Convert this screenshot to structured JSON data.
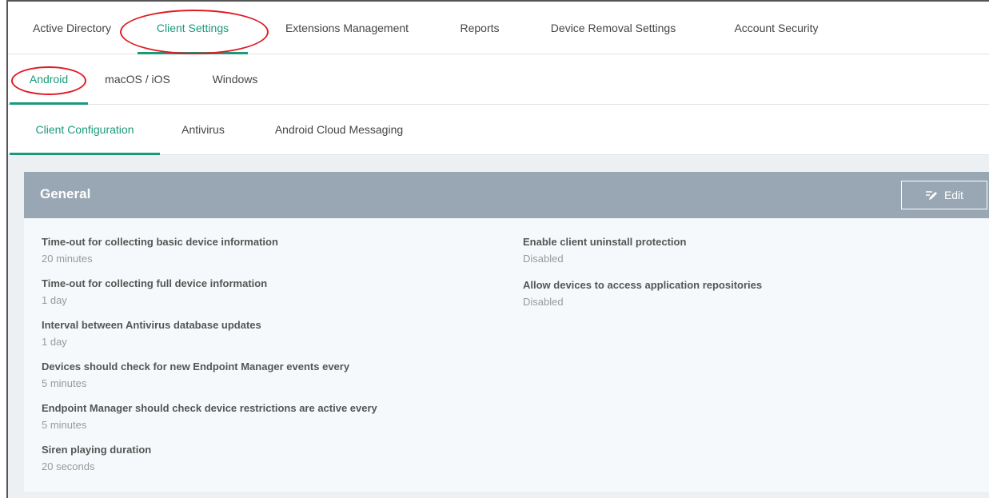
{
  "top_tabs": [
    "Active Directory",
    "Client Settings",
    "Extensions Management",
    "Reports",
    "Device Removal Settings",
    "Account Security"
  ],
  "os_tabs": [
    "Android",
    "macOS / iOS",
    "Windows"
  ],
  "section_tabs": [
    "Client Configuration",
    "Antivirus",
    "Android Cloud Messaging"
  ],
  "card": {
    "title": "General",
    "edit_label": "Edit",
    "left_fields": [
      {
        "label": "Time-out for collecting basic device information",
        "value": "20 minutes"
      },
      {
        "label": "Time-out for collecting full device information",
        "value": "1 day"
      },
      {
        "label": "Interval between Antivirus database updates",
        "value": "1 day"
      },
      {
        "label": "Devices should check for new Endpoint Manager events every",
        "value": "5 minutes"
      },
      {
        "label": "Endpoint Manager should check device restrictions are active every",
        "value": "5 minutes"
      },
      {
        "label": "Siren playing duration",
        "value": "20 seconds"
      }
    ],
    "right_fields": [
      {
        "label": "Enable client uninstall protection",
        "value": "Disabled"
      },
      {
        "label": "Allow devices to access application repositories",
        "value": "Disabled"
      }
    ]
  },
  "colors": {
    "accent": "#1a9a7b",
    "header_bg": "#98a7b3",
    "annotation": "#e01b24"
  }
}
